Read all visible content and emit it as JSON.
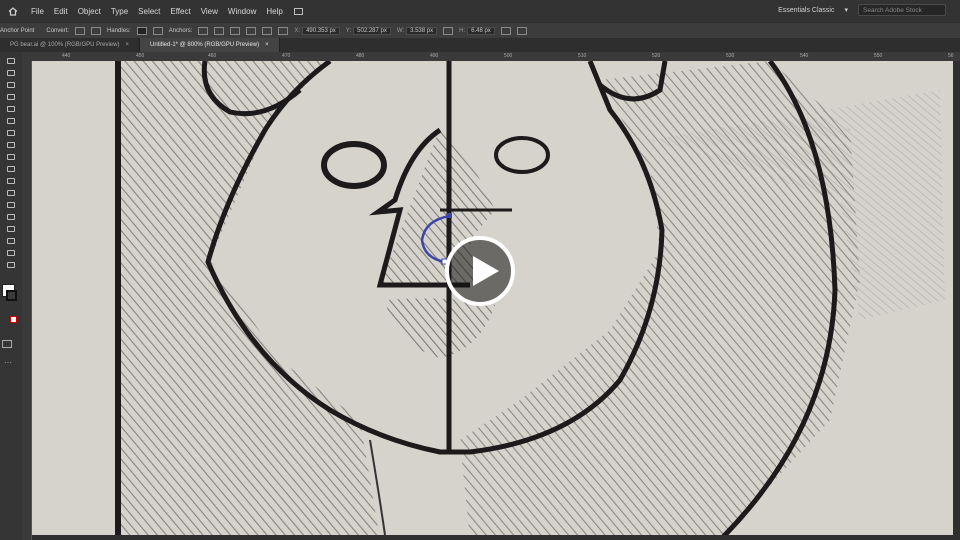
{
  "menubar": {
    "items": [
      "File",
      "Edit",
      "Object",
      "Type",
      "Select",
      "Effect",
      "View",
      "Window",
      "Help"
    ],
    "workspace": "Essentials Classic",
    "search_placeholder": "Search Adobe Stock"
  },
  "controlbar": {
    "tool_label": "Anchor Point",
    "convert_label": "Convert:",
    "handles_label": "Handles:",
    "anchors_label": "Anchors:",
    "x_label": "X:",
    "x_value": "490.353 px",
    "y_label": "Y:",
    "y_value": "502.287 px",
    "w_label": "W:",
    "w_value": "3.538 px",
    "h_label": "H:",
    "h_value": "6.48 px"
  },
  "tabs": [
    {
      "label": "PG bear.ai @ 100% (RGB/GPU Preview)",
      "active": false
    },
    {
      "label": "Untitled-1* @ 800% (RGB/GPU Preview)",
      "active": true
    }
  ],
  "ruler": {
    "ticks": [
      "440",
      "450",
      "460",
      "470",
      "480",
      "490",
      "500",
      "510",
      "520",
      "530",
      "540",
      "550",
      "56"
    ]
  },
  "colors": {
    "ui_dark": "#333333",
    "paper": "#d6d3cd",
    "ink": "#1c1a1b",
    "path_selection": "#3c46a8",
    "play_button": "#ffffff"
  },
  "icons": {
    "home": "home-icon",
    "play": "play-icon"
  }
}
